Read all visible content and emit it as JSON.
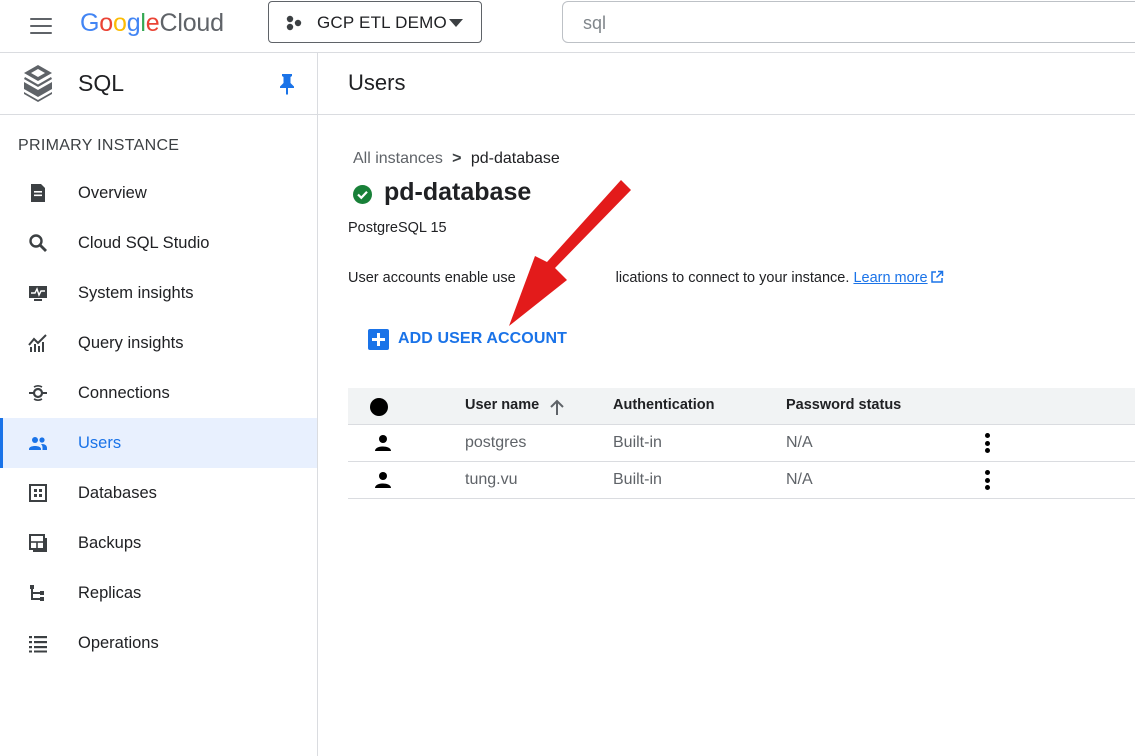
{
  "header": {
    "logo_google": {
      "G": "G",
      "o1": "o",
      "o2": "o",
      "g": "g",
      "l": "l",
      "e": "e"
    },
    "logo_cloud": "Cloud",
    "project_name": "GCP ETL DEMO",
    "search_value": "sql"
  },
  "sidebar": {
    "product_title": "SQL",
    "section_label": "PRIMARY INSTANCE",
    "items": [
      {
        "label": "Overview",
        "icon": "overview-icon"
      },
      {
        "label": "Cloud SQL Studio",
        "icon": "search-icon"
      },
      {
        "label": "System insights",
        "icon": "monitor-icon"
      },
      {
        "label": "Query insights",
        "icon": "chart-icon"
      },
      {
        "label": "Connections",
        "icon": "connections-icon"
      },
      {
        "label": "Users",
        "icon": "users-icon",
        "active": true
      },
      {
        "label": "Databases",
        "icon": "databases-icon"
      },
      {
        "label": "Backups",
        "icon": "backups-icon"
      },
      {
        "label": "Replicas",
        "icon": "replicas-icon"
      },
      {
        "label": "Operations",
        "icon": "list-icon"
      }
    ]
  },
  "main": {
    "page_title": "Users",
    "breadcrumb": {
      "parent": "All instances",
      "separator": ">",
      "current": "pd-database"
    },
    "instance": {
      "name": "pd-database",
      "status": "running",
      "version": "PostgreSQL 15"
    },
    "description": {
      "start": "User accounts enable use",
      "end": "lications to connect to your instance.",
      "link": "Learn more"
    },
    "add_button_label": "ADD USER ACCOUNT",
    "table": {
      "columns": [
        "User name",
        "Authentication",
        "Password status"
      ],
      "rows": [
        {
          "user_name": "postgres",
          "authentication": "Built-in",
          "password_status": "N/A"
        },
        {
          "user_name": "tung.vu",
          "authentication": "Built-in",
          "password_status": "N/A"
        }
      ]
    }
  },
  "colors": {
    "accent": "#1a73e8",
    "status_ok": "#188038",
    "annotation_arrow": "#e31b1b"
  }
}
